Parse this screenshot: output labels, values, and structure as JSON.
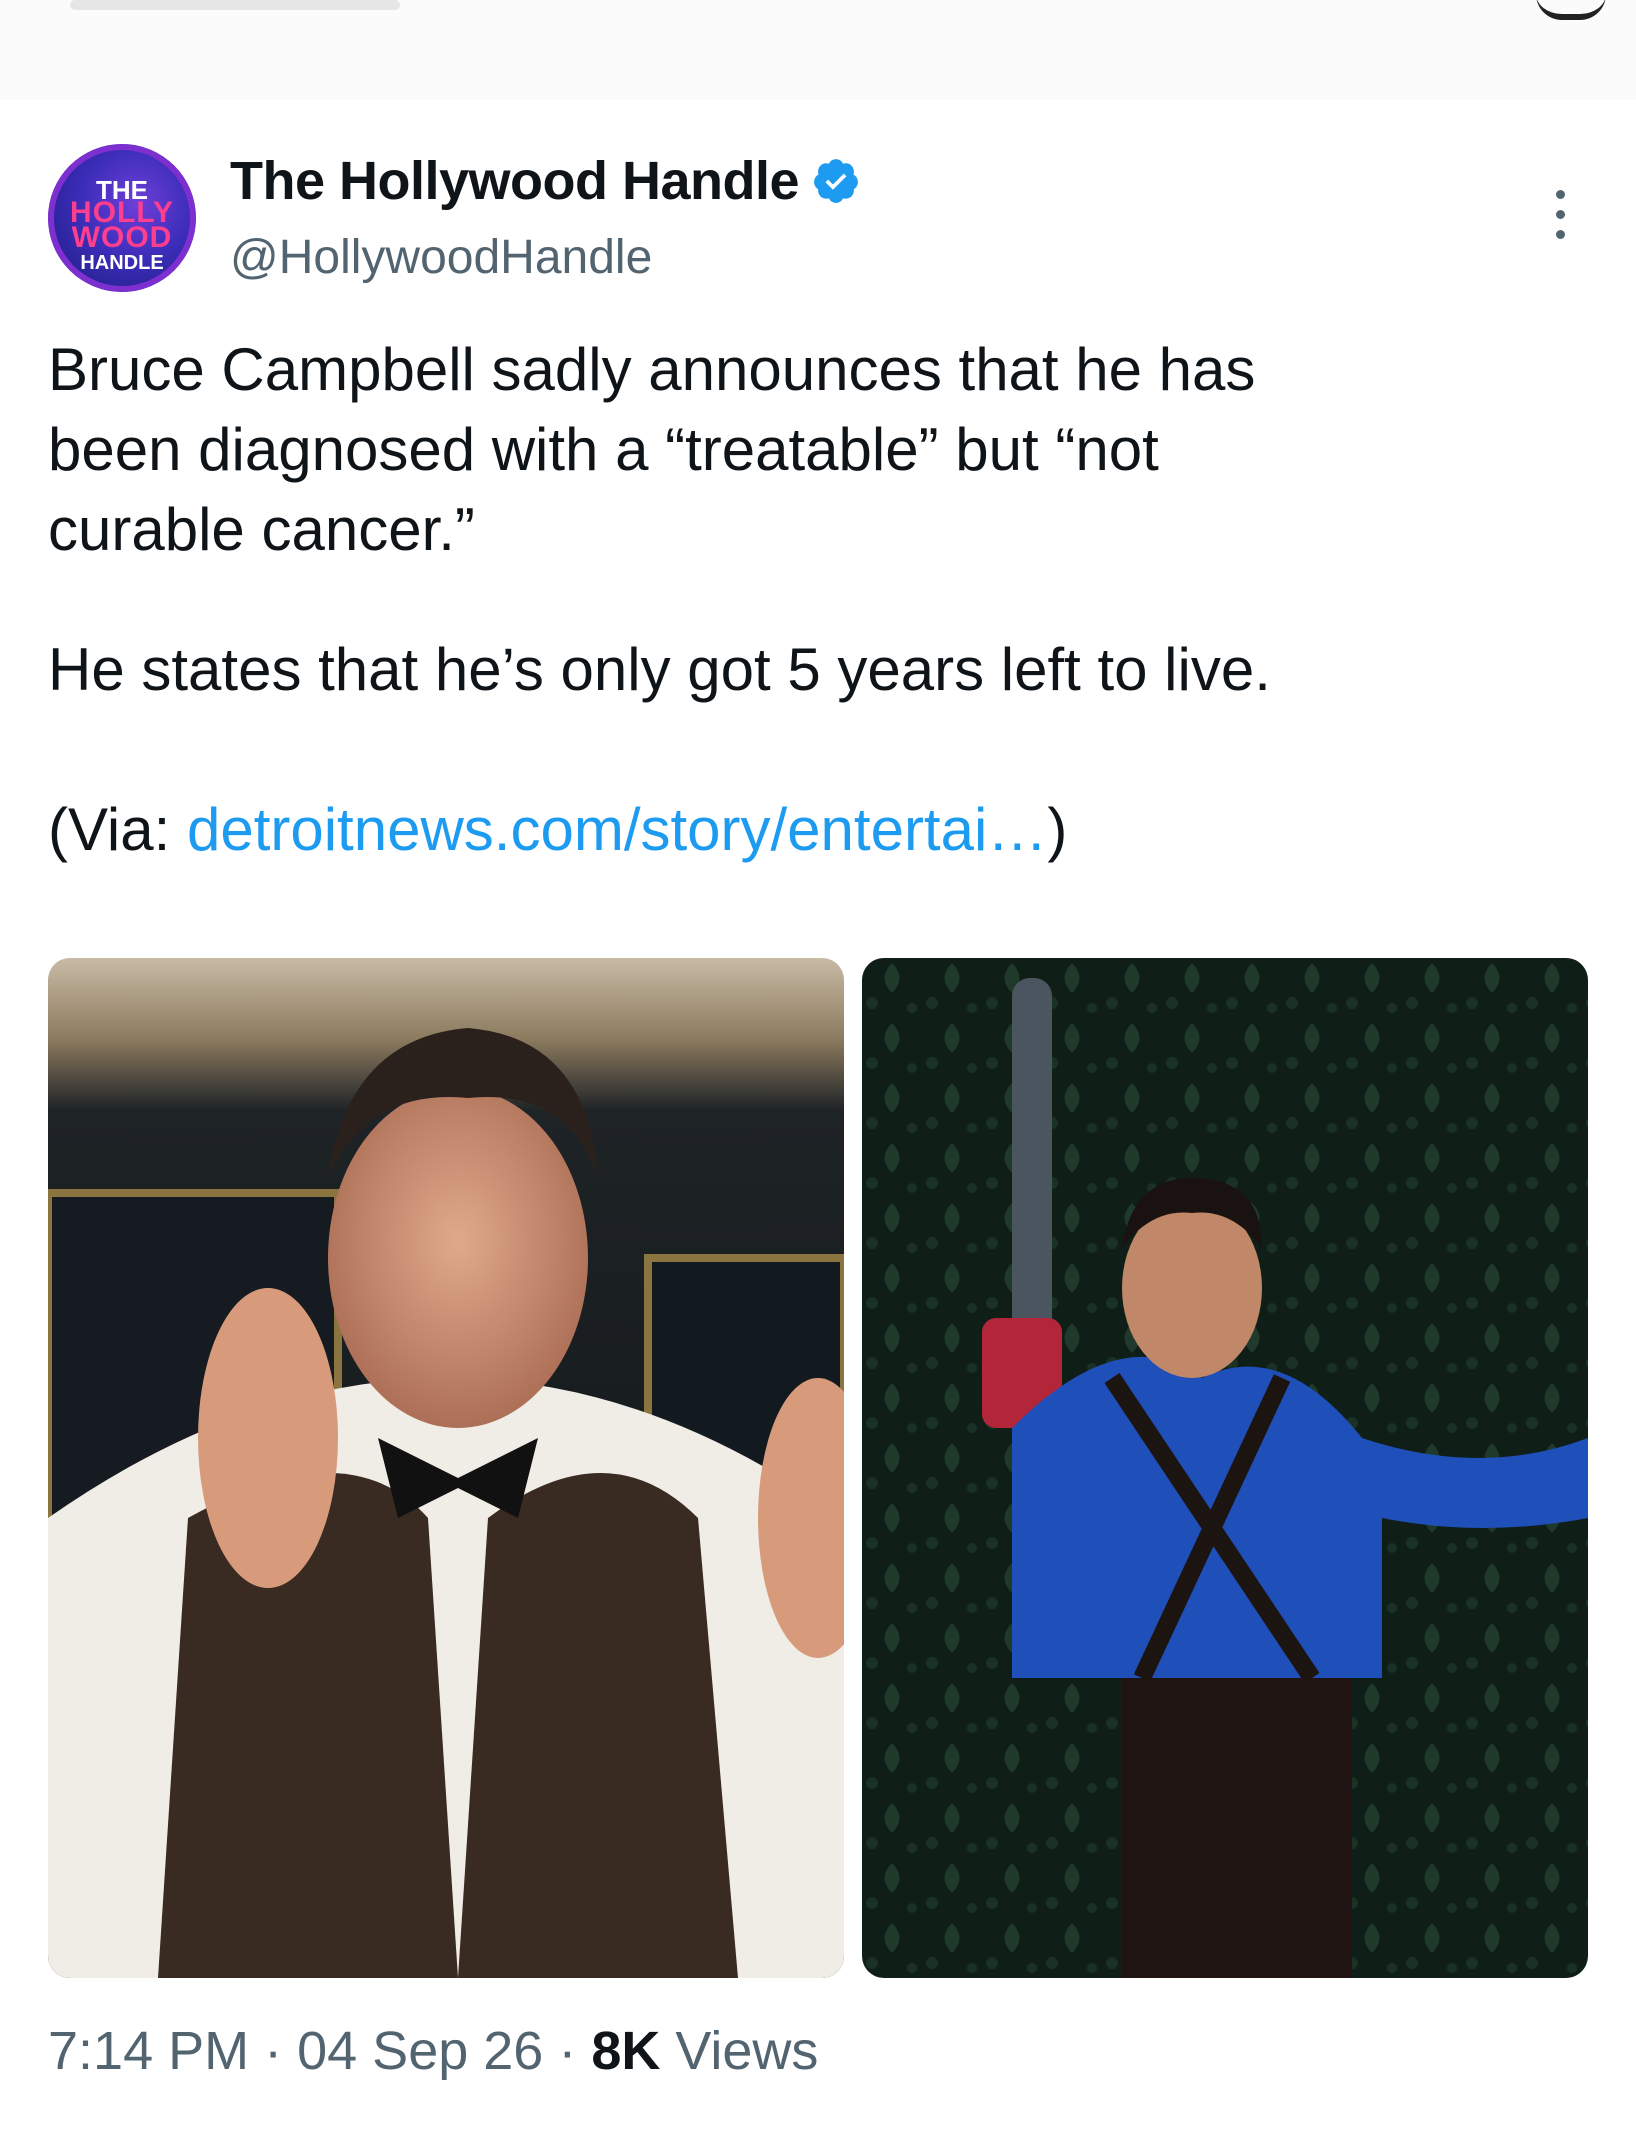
{
  "tweet": {
    "display_name": "The Hollywood Handle",
    "handle": "@HollywoodHandle",
    "avatar_text": [
      "THE",
      "HOLLY",
      "WOOD",
      "HANDLE"
    ],
    "icons": {
      "verified": "verified-badge-icon",
      "more": "more-options-icon"
    },
    "text": {
      "paragraph1": "Bruce Campbell sadly announces that he has\nbeen diagnosed with a “treatable” but “not\ncurable cancer.”",
      "paragraph2": "He states that he’s only got 5 years left to live.",
      "via_prefix": "(Via: ",
      "via_link": "detroitnews.com/story/entertai…",
      "via_suffix": ")"
    },
    "media": [
      {
        "description_name": "photo-man-in-vest-bowtie"
      },
      {
        "description_name": "photo-man-with-chainsaw"
      }
    ],
    "footer": {
      "time": "7:14 PM",
      "separator": " · ",
      "date": "04 Sep 26",
      "views_count": "8K",
      "views_label": " Views"
    },
    "colors": {
      "link": "#1d9bf0",
      "verified": "#1d9bf0",
      "secondary_text": "#536471",
      "primary_text": "#0f1419"
    }
  }
}
